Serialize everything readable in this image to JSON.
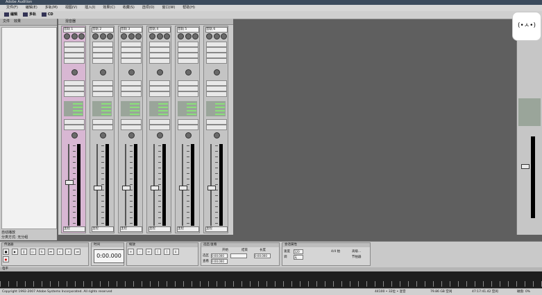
{
  "window": {
    "title": "Adobe Audition"
  },
  "menu": [
    "文件(F)",
    "编辑(E)",
    "多轨(M)",
    "视图(V)",
    "插入(I)",
    "效果(C)",
    "收藏(S)",
    "选项(O)",
    "窗口(W)",
    "帮助(H)"
  ],
  "toolbar": {
    "items": [
      "编辑",
      "多轨",
      "CD"
    ]
  },
  "left_panel": {
    "tabs": [
      "文件",
      "效果"
    ],
    "footer_label": "自动播放",
    "group_label": "分类方式:",
    "group_value": "无分组"
  },
  "mixer": {
    "tab": "混音器",
    "strips": [
      "音轨 1",
      "音轨 2",
      "音轨 3",
      "音轨 4",
      "音轨 5",
      "音轨 6"
    ],
    "bus_label": "主控"
  },
  "badge": {
    "text": "(•ㅅ•)"
  },
  "transport": {
    "title": "传送器"
  },
  "time_panel": {
    "title": "时间",
    "value": "0:00.000"
  },
  "zoom_panel": {
    "title": "缩放"
  },
  "selection_panel": {
    "title": "选区/查看",
    "col_start": "开始",
    "col_end": "结束",
    "col_len": "长度",
    "row_sel": "选区",
    "row_view": "查看",
    "v1": "0:00.000",
    "v2": "0:00.000",
    "v3": "0:00.000"
  },
  "session_panel": {
    "title": "会话属性",
    "tempo_label": "速度",
    "tempo_value": "120",
    "key_label": "调",
    "key_value": "无",
    "time_sig": "4/4 拍",
    "advanced": "高级...",
    "metronome": "节拍器"
  },
  "timeline": {
    "title": "电平"
  },
  "status": {
    "copyright": "Copyright 1992-2007 Adobe Systems Incorporated. All rights reserved",
    "sample": "44100 • 32位 • 混音",
    "free": "79.86 GB 空闲",
    "time": "47:17:41.42 空闲",
    "disk": "磁盘: 0%"
  }
}
